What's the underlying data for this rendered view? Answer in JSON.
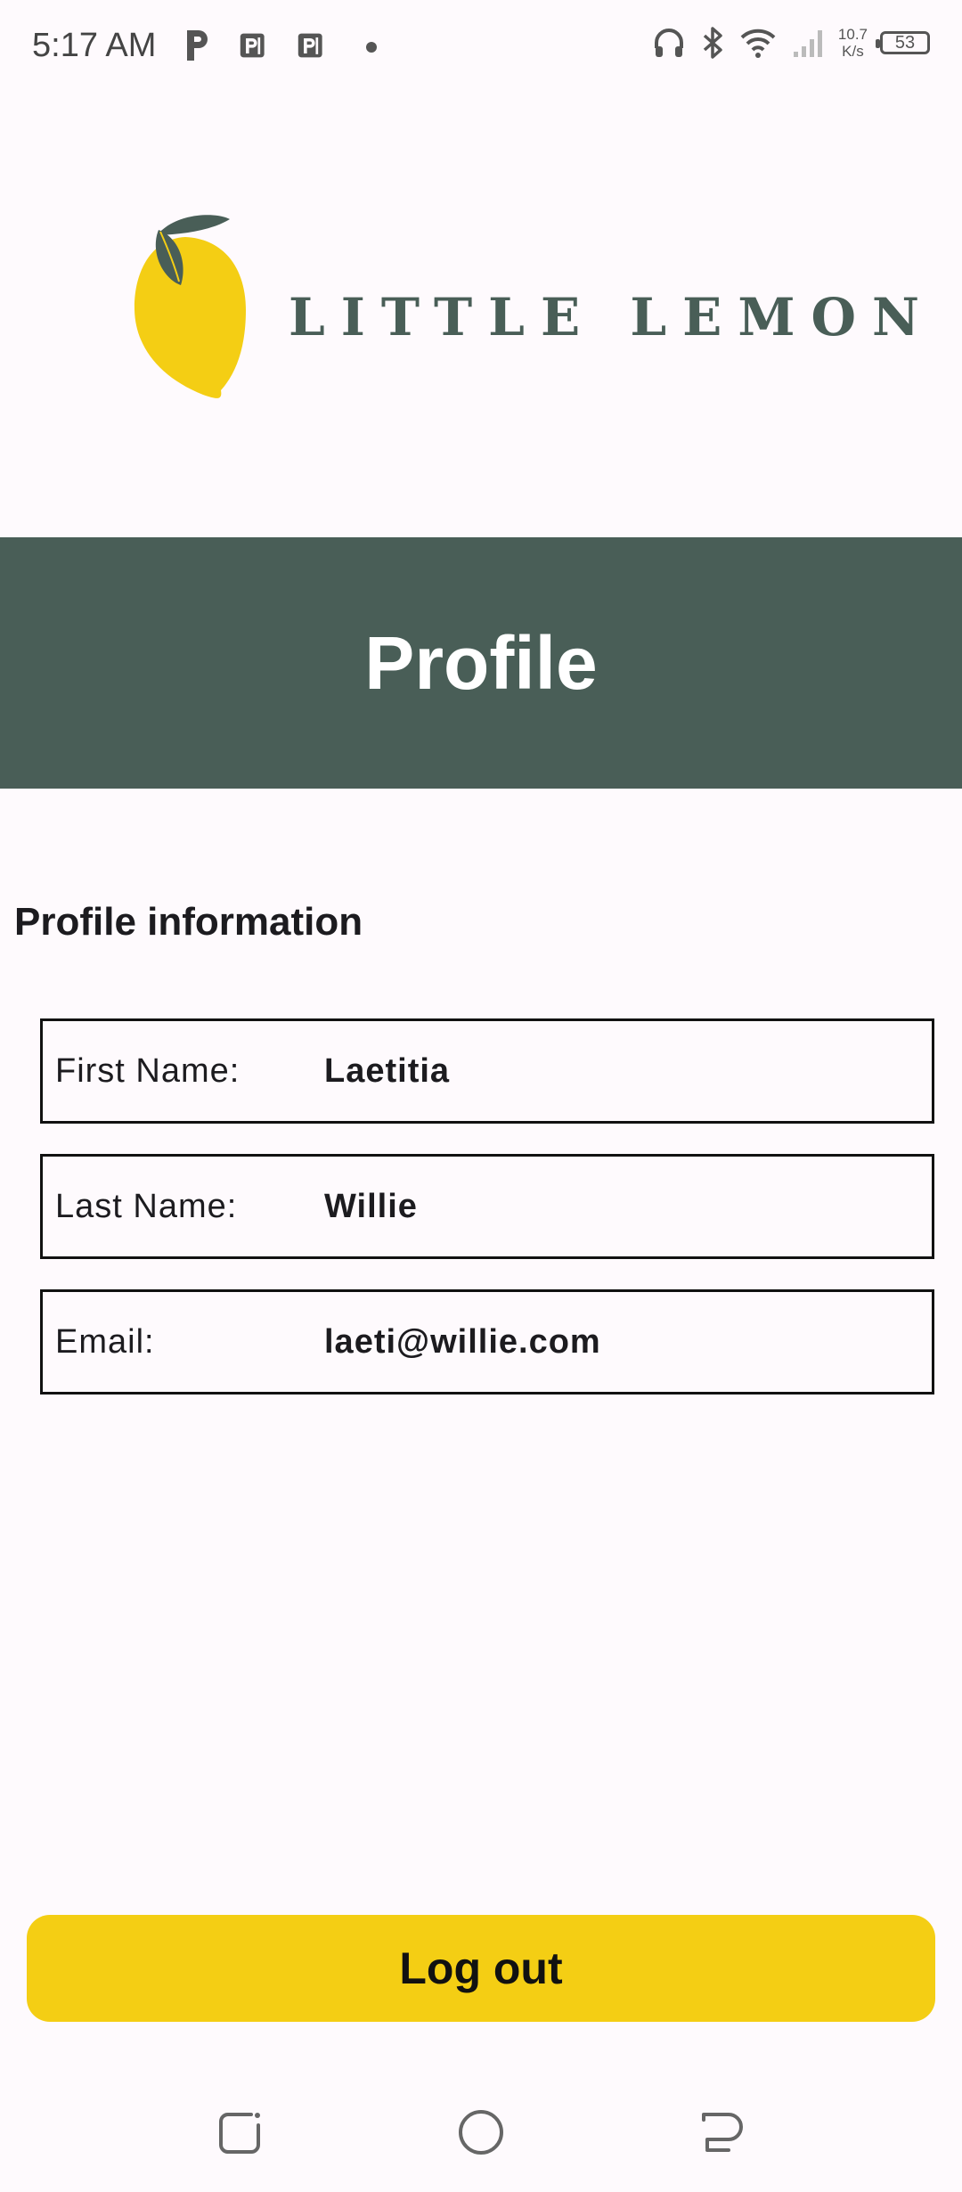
{
  "status_bar": {
    "time": "5:17 AM",
    "net_speed_value": "10.7",
    "net_speed_unit": "K/s",
    "battery": "53",
    "left_icons": [
      "parking-icon",
      "app-icon",
      "app-icon",
      "dot-icon"
    ],
    "right_icons": [
      "headphones-icon",
      "bluetooth-icon",
      "wifi-icon",
      "signal-icon",
      "battery-icon"
    ]
  },
  "brand": {
    "name": "LITTLE LEMON",
    "colors": {
      "primary": "#495e57",
      "accent": "#f4ce14",
      "background": "#fefafd"
    }
  },
  "header": {
    "title": "Profile"
  },
  "profile": {
    "section_title": "Profile information",
    "fields": [
      {
        "label": "First Name:",
        "value": "Laetitia"
      },
      {
        "label": "Last Name:",
        "value": "Willie"
      },
      {
        "label": "Email:",
        "value": "laeti@willie.com"
      }
    ]
  },
  "actions": {
    "logout_label": "Log out"
  },
  "nav": {
    "buttons": [
      "recent-apps-icon",
      "home-icon",
      "back-icon"
    ]
  }
}
